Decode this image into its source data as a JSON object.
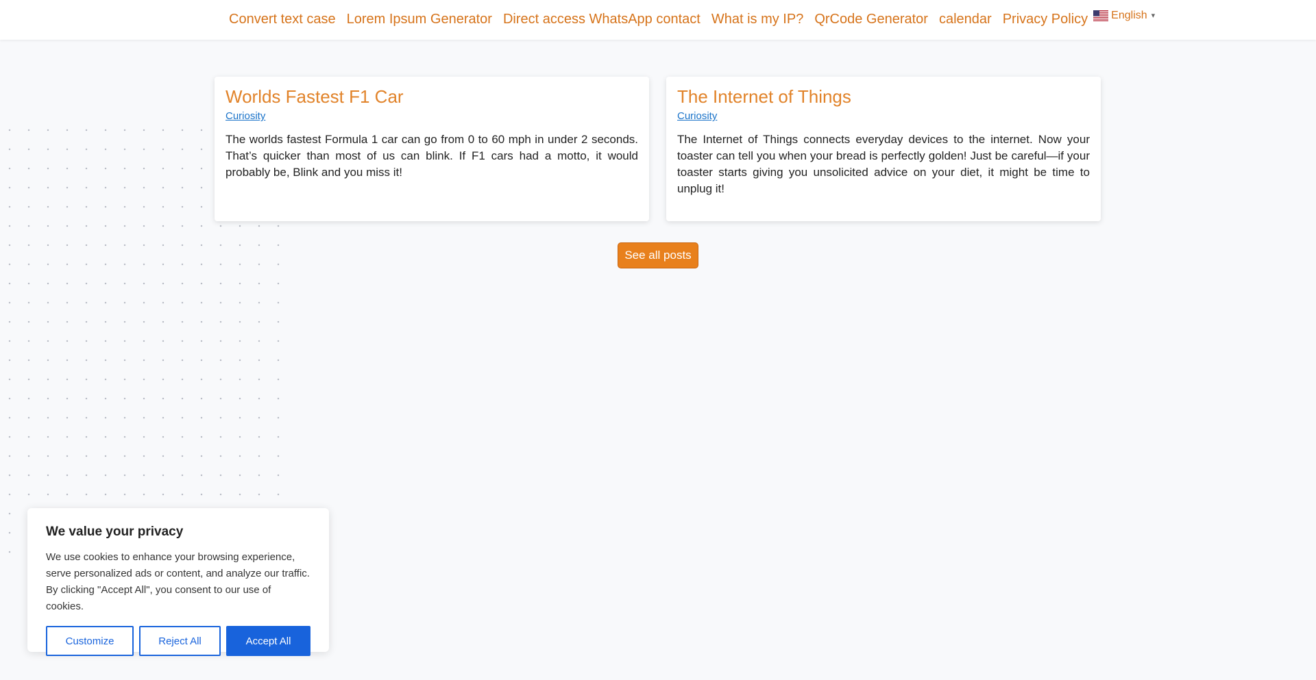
{
  "nav": {
    "items": [
      {
        "label": "Convert text case"
      },
      {
        "label": "Lorem Ipsum Generator"
      },
      {
        "label": "Direct access WhatsApp contact"
      },
      {
        "label": "What is my IP?"
      },
      {
        "label": "QrCode Generator"
      },
      {
        "label": "calendar"
      },
      {
        "label": "Privacy Policy"
      }
    ],
    "language": {
      "label": "English",
      "flag_icon": "us-flag-icon",
      "caret": "▾"
    }
  },
  "posts": [
    {
      "title": "Worlds Fastest F1 Car",
      "category": "Curiosity",
      "excerpt": "The worlds fastest Formula 1 car can go from 0 to 60 mph in under 2 seconds. That’s quicker than most of us can blink. If F1 cars had a motto, it would probably be, Blink and you miss it!"
    },
    {
      "title": "The Internet of Things",
      "category": "Curiosity",
      "excerpt": "The Internet of Things connects everyday devices to the internet. Now your toaster can tell you when your bread is perfectly golden! Just be careful—if your toaster starts giving you unsolicited advice on your diet, it might be time to unplug it!"
    }
  ],
  "see_all_label": "See all posts",
  "cookie": {
    "title": "We value your privacy",
    "text": "We use cookies to enhance your browsing experience, serve personalized ads or content, and analyze our traffic. By clicking \"Accept All\", you consent to our use of cookies.",
    "customize_label": "Customize",
    "reject_label": "Reject All",
    "accept_label": "Accept All"
  },
  "colors": {
    "accent": "#e1832a",
    "link": "#1a73c9",
    "cookie_primary": "#1863dc"
  }
}
